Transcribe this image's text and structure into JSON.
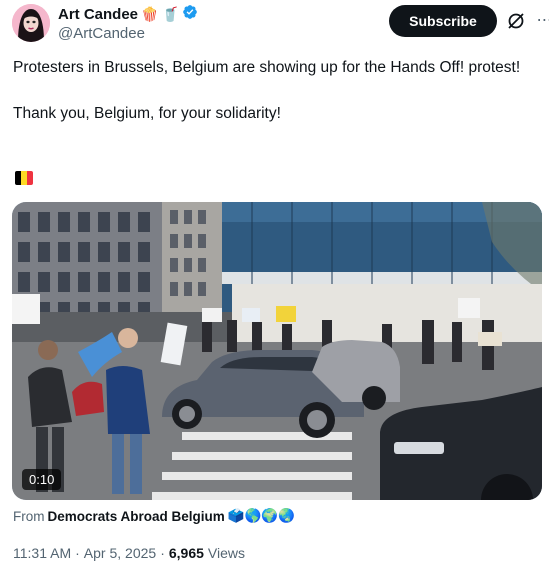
{
  "author": {
    "display_name": "Art Candee",
    "emojis": [
      "🍿",
      "🥤"
    ],
    "handle": "@ArtCandee",
    "verified_color": "#1d9bf0"
  },
  "actions": {
    "subscribe_label": "Subscribe"
  },
  "tweet": {
    "line1": "Protesters in Brussels, Belgium are showing up for the Hands Off! protest!",
    "line2": "Thank you, Belgium, for your solidarity!",
    "flag_colors": [
      "#000000",
      "#fdda24",
      "#ef3340"
    ]
  },
  "media": {
    "duration": "0:10"
  },
  "source": {
    "prefix": "From",
    "name": "Democrats Abroad Belgium",
    "emojis": "🗳️🌎🌍🌏"
  },
  "meta": {
    "time": "11:31 AM",
    "sep1": "·",
    "date": "Apr 5, 2025",
    "sep2": "·",
    "views_count": "6,965",
    "views_label": "Views"
  },
  "colors": {
    "text": "#0f1419",
    "secondary": "#536471",
    "button_bg": "#0f1419"
  }
}
